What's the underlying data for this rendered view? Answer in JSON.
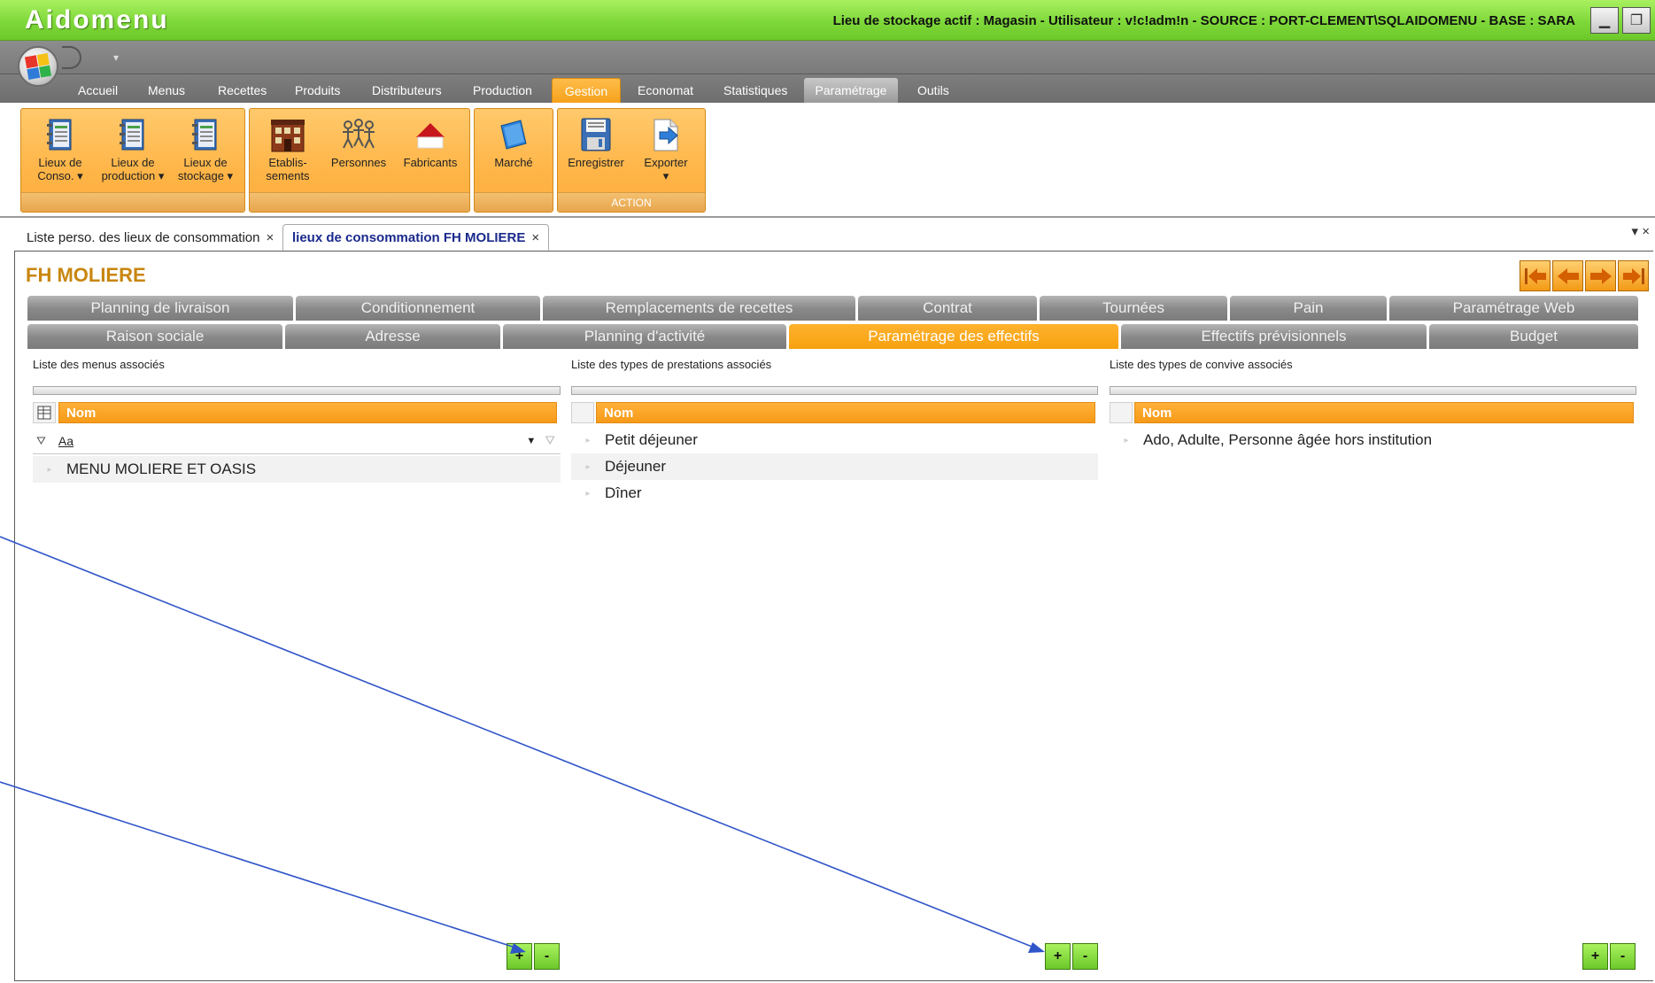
{
  "app": {
    "name": "Aidomenu",
    "status": "Lieu de stockage actif : Magasin - Utilisateur : v!c!adm!n - SOURCE : PORT-CLEMENT\\SQLAIDOMENU - BASE : SARA"
  },
  "menu_tabs": [
    {
      "label": "Accueil"
    },
    {
      "label": "Menus"
    },
    {
      "label": "Recettes"
    },
    {
      "label": "Produits"
    },
    {
      "label": "Distributeurs"
    },
    {
      "label": "Production"
    },
    {
      "label": "Gestion",
      "active": true
    },
    {
      "label": "Economat"
    },
    {
      "label": "Statistiques"
    },
    {
      "label": "Paramétrage",
      "contextual": true
    },
    {
      "label": "Outils"
    }
  ],
  "ribbon": {
    "buttons": [
      {
        "label": "Lieux de\nConso. ▾",
        "icon": "binder-icon"
      },
      {
        "label": "Lieux de\nproduction ▾",
        "icon": "binder-icon"
      },
      {
        "label": "Lieux de\nstockage ▾",
        "icon": "binder-icon"
      },
      {
        "label": "Etablis-\nsements",
        "icon": "building-icon"
      },
      {
        "label": "Personnes",
        "icon": "people-icon"
      },
      {
        "label": "Fabricants",
        "icon": "house-roof-icon"
      },
      {
        "label": "Marché",
        "icon": "market-icon"
      },
      {
        "label": "Enregistrer",
        "icon": "floppy-disk-icon"
      },
      {
        "label": "Exporter\n▾",
        "icon": "export-arrow-icon"
      }
    ],
    "action_group_label": "ACTION"
  },
  "doc_tabs": [
    {
      "label": "Liste perso. des lieux de consommation",
      "close": "×"
    },
    {
      "label": "lieux de consommation FH MOLIERE",
      "close": "×",
      "active": true
    }
  ],
  "doc_controls": "▾ ×",
  "page": {
    "title": "FH MOLIERE",
    "subtabs_row1": [
      "Planning de livraison",
      "Conditionnement",
      "Remplacements de recettes",
      "Contrat",
      "Tournées",
      "Pain",
      "Paramétrage Web"
    ],
    "subtabs_row2": [
      "Raison sociale",
      "Adresse",
      "Planning d'activité",
      "Paramétrage des effectifs",
      "Effectifs prévisionnels",
      "Budget"
    ],
    "active_subtab": "Paramétrage des effectifs"
  },
  "lists": [
    {
      "caption": "Liste des menus associés",
      "header": "Nom",
      "filter_text": "Aa",
      "rows": [
        "MENU MOLIERE ET OASIS"
      ]
    },
    {
      "caption": "Liste des types de prestations associés",
      "header": "Nom",
      "rows": [
        "Petit déjeuner",
        "Déjeuner",
        "Dîner"
      ]
    },
    {
      "caption": "Liste des types de convive associés",
      "header": "Nom",
      "rows": [
        "Ado, Adulte, Personne âgée hors institution"
      ]
    }
  ],
  "buttons": {
    "add": "+",
    "remove": "-"
  },
  "colors": {
    "accent_orange": "#f7a10f",
    "title_green": "#7fd83a",
    "annotation_blue": "#2f55c8"
  }
}
